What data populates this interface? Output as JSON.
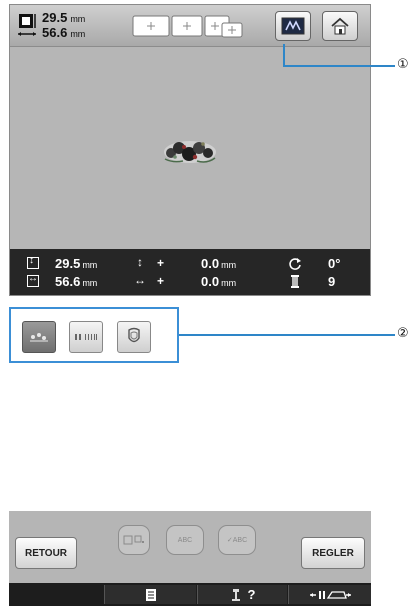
{
  "header": {
    "height_value": "29.5",
    "width_value": "56.6",
    "unit": "mm"
  },
  "icons": {
    "size": "size-icon",
    "hoops": "hoop-frames-icon",
    "embroidery_display": "embroidery-display-icon",
    "home": "home-icon",
    "height": "height-icon",
    "width": "width-icon",
    "vertical_move": "vertical-move-icon",
    "horizontal_move": "horizontal-move-icon",
    "rotate": "rotate-icon",
    "color_count": "thread-spool-icon",
    "edit": "edit-pattern-icon",
    "stitch_density": "stitch-density-icon",
    "appliqué": "applique-icon",
    "mirror": "mirror-icon",
    "text": "text-abc-icon",
    "check_text": "check-abc-icon",
    "list": "list-icon",
    "help": "help-icon",
    "foot": "presser-foot-icon"
  },
  "info": {
    "height": "29.5",
    "width": "56.6",
    "height_unit": "mm",
    "width_unit": "mm",
    "vertical_move": "0.0",
    "horizontal_move": "0.0",
    "move_unit": "mm",
    "plus": "+",
    "rotation": "0°",
    "color_count": "9"
  },
  "callouts": {
    "one": "①",
    "two": "②"
  },
  "text_icons": {
    "abc": "ABC",
    "check_abc": "✓ABC"
  },
  "bottom": {
    "back_label": "RETOUR",
    "set_label": "REGLER",
    "help_mark": "?"
  },
  "colors": {
    "screen_bg": "#b4b4b4",
    "info_bar": "#262626",
    "callout_blue": "#2e86c8"
  }
}
